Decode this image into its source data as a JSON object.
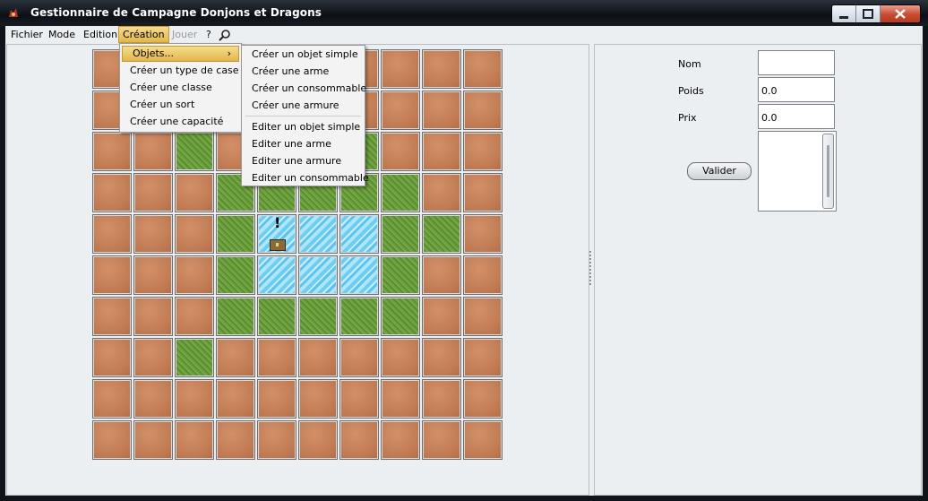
{
  "window": {
    "title": "Gestionnaire de Campagne Donjons et Dragons"
  },
  "menubar": {
    "items": [
      {
        "label": "Fichier",
        "state": "normal"
      },
      {
        "label": "Mode",
        "state": "normal"
      },
      {
        "label": "Edition",
        "state": "normal"
      },
      {
        "label": "Création",
        "state": "active"
      },
      {
        "label": "Jouer",
        "state": "disabled"
      },
      {
        "label": "?",
        "state": "normal"
      }
    ]
  },
  "creation_menu": {
    "items": [
      "Objets...",
      "Créer un type de case",
      "Créer une classe",
      "Créer un sort",
      "Créer une capacité"
    ],
    "submenu_arrow": "›"
  },
  "objets_submenu": {
    "create_items": [
      "Créer un objet simple",
      "Créer une arme",
      "Créer un consommable",
      "Créer une armure"
    ],
    "edit_items": [
      "Editer un objet simple",
      "Editer une arme",
      "Editer une armure",
      "Editer un consommable"
    ]
  },
  "map": {
    "rows": [
      [
        "dirt",
        "dirt",
        "dirt",
        "dirt",
        "dirt",
        "dirt",
        "dirt",
        "dirt",
        "dirt",
        "dirt"
      ],
      [
        "dirt",
        "dirt",
        "dirt",
        "dirt",
        "dirt",
        "dirt",
        "dirt",
        "dirt",
        "dirt",
        "dirt"
      ],
      [
        "dirt",
        "dirt",
        "grass",
        "dirt",
        "dirt",
        "dirt",
        "grass",
        "dirt",
        "dirt",
        "dirt"
      ],
      [
        "dirt",
        "dirt",
        "dirt",
        "grass",
        "grass",
        "grass",
        "grass",
        "grass",
        "dirt",
        "dirt"
      ],
      [
        "dirt",
        "dirt",
        "dirt",
        "grass",
        "water",
        "water",
        "water",
        "grass",
        "grass",
        "dirt"
      ],
      [
        "dirt",
        "dirt",
        "dirt",
        "grass",
        "water",
        "water",
        "water",
        "grass",
        "dirt",
        "dirt"
      ],
      [
        "dirt",
        "dirt",
        "dirt",
        "grass",
        "grass",
        "grass",
        "grass",
        "grass",
        "dirt",
        "dirt"
      ],
      [
        "dirt",
        "dirt",
        "grass",
        "dirt",
        "dirt",
        "dirt",
        "dirt",
        "dirt",
        "dirt",
        "dirt"
      ],
      [
        "dirt",
        "dirt",
        "dirt",
        "dirt",
        "dirt",
        "dirt",
        "dirt",
        "dirt",
        "dirt",
        "dirt"
      ],
      [
        "dirt",
        "dirt",
        "dirt",
        "dirt",
        "dirt",
        "dirt",
        "dirt",
        "dirt",
        "dirt",
        "dirt"
      ]
    ],
    "marker_tile": {
      "row": 4,
      "col": 4,
      "mark": "!",
      "object": "treasure-chest-icon"
    }
  },
  "form": {
    "nom_label": "Nom",
    "nom_value": "",
    "poids_label": "Poids",
    "poids_value": "0.0",
    "prix_label": "Prix",
    "prix_value": "0.0",
    "valider_label": "Valider"
  }
}
